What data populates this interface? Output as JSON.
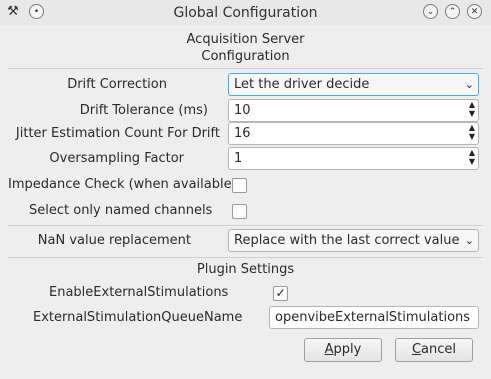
{
  "window": {
    "title": "Global Configuration",
    "app_icon": "x-tool-icon",
    "menu_icon": "dot-icon",
    "minimize_icon": "chevron-down-icon",
    "maximize_icon": "chevron-up-icon",
    "close_icon": "close-icon"
  },
  "section1": {
    "title_line1": "Acquisition Server",
    "title_line2": "Configuration"
  },
  "drift_correction": {
    "label": "Drift Correction",
    "value": "Let the driver decide"
  },
  "drift_tolerance": {
    "label": "Drift Tolerance (ms)",
    "value": "10"
  },
  "jitter": {
    "label": "Jitter Estimation Count For Drift",
    "value": "16"
  },
  "oversampling": {
    "label": "Oversampling Factor",
    "value": "1"
  },
  "impedance": {
    "label": "Impedance Check (when available)",
    "checked": false
  },
  "named_channels": {
    "label": "Select only named channels",
    "checked": false
  },
  "nan": {
    "label": "NaN value replacement",
    "value": "Replace with the last correct value"
  },
  "plugins": {
    "title": "Plugin Settings",
    "ext_stim": {
      "label": "EnableExternalStimulations",
      "checked": true,
      "mark": "✓"
    },
    "queue": {
      "label": "ExternalStimulationQueueName",
      "value": "openvibeExternalStimulations"
    }
  },
  "buttons": {
    "apply_first": "A",
    "apply_rest": "pply",
    "cancel_first": "C",
    "cancel_rest": "ancel"
  },
  "colors": {
    "focus": "#3daee9",
    "background": "#eeeeee"
  }
}
